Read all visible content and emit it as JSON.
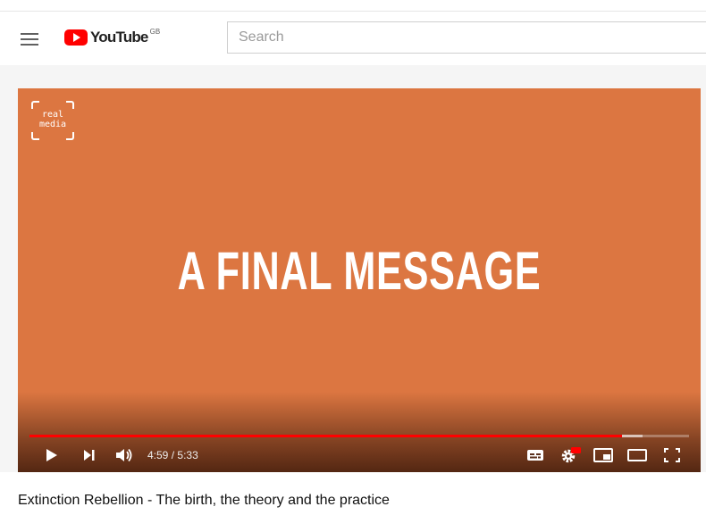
{
  "masthead": {
    "logo_text": "YouTube",
    "region": "GB",
    "search_placeholder": "Search"
  },
  "player": {
    "channel_badge_line1": "real",
    "channel_badge_line2": "media",
    "frame_text": "A FINAL MESSAGE",
    "frame_background_color": "#dc7641",
    "time_current": "4:59",
    "time_separator": "/",
    "time_total": "5:33",
    "progress_played_fraction": 0.899,
    "progress_buffered_fraction": 0.93,
    "progress_color": "#ff0000",
    "controls": [
      "play-icon",
      "next-icon",
      "volume-icon",
      "subtitles-icon",
      "settings-icon",
      "miniplayer-icon",
      "theater-mode-icon",
      "fullscreen-icon"
    ],
    "settings_badge": "HD"
  },
  "video": {
    "title": "Extinction Rebellion - The birth, the theory and the practice"
  }
}
